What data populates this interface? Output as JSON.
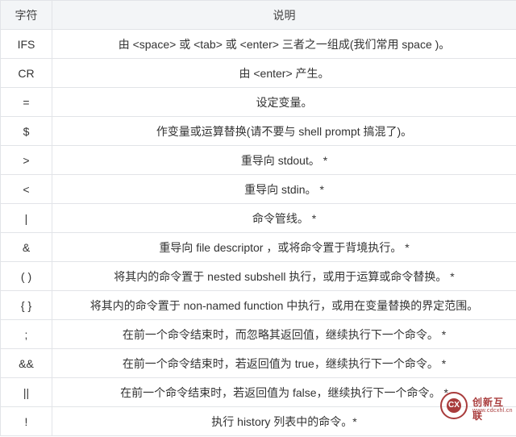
{
  "table": {
    "headers": {
      "col1": "字符",
      "col2": "说明"
    },
    "rows": [
      {
        "sym": "IFS",
        "desc": "由 <space> 或 <tab> 或 <enter> 三者之一组成(我们常用 space )。"
      },
      {
        "sym": "CR",
        "desc": "由 <enter> 产生。"
      },
      {
        "sym": "=",
        "desc": "设定变量。"
      },
      {
        "sym": "$",
        "desc": "作变量或运算替换(请不要与 shell prompt 搞混了)。"
      },
      {
        "sym": ">",
        "desc": "重导向 stdout。  *"
      },
      {
        "sym": "<",
        "desc": "重导向 stdin。  *"
      },
      {
        "sym": "|",
        "desc": "命令管线。  *"
      },
      {
        "sym": "&",
        "desc": "重导向 file descriptor  ，或将命令置于背境执行。  *"
      },
      {
        "sym": "( )",
        "desc": "将其内的命令置于 nested subshell 执行，或用于运算或命令替换。  *"
      },
      {
        "sym": "{ }",
        "desc": "将其内的命令置于 non-named function 中执行，或用在变量替换的界定范围。"
      },
      {
        "sym": ";",
        "desc": "在前一个命令结束时，而忽略其返回值，继续执行下一个命令。  *"
      },
      {
        "sym": "&&",
        "desc": "在前一个命令结束时，若返回值为 true，继续执行下一个命令。  *"
      },
      {
        "sym": "||",
        "desc": "在前一个命令结束时，若返回值为 false，继续执行下一个命令。  *"
      },
      {
        "sym": "!",
        "desc": "执行 history 列表中的命令。*"
      }
    ]
  },
  "watermark": {
    "inner": "CX",
    "text": "创新互联",
    "sub": "www.cdcxhl.cn"
  }
}
